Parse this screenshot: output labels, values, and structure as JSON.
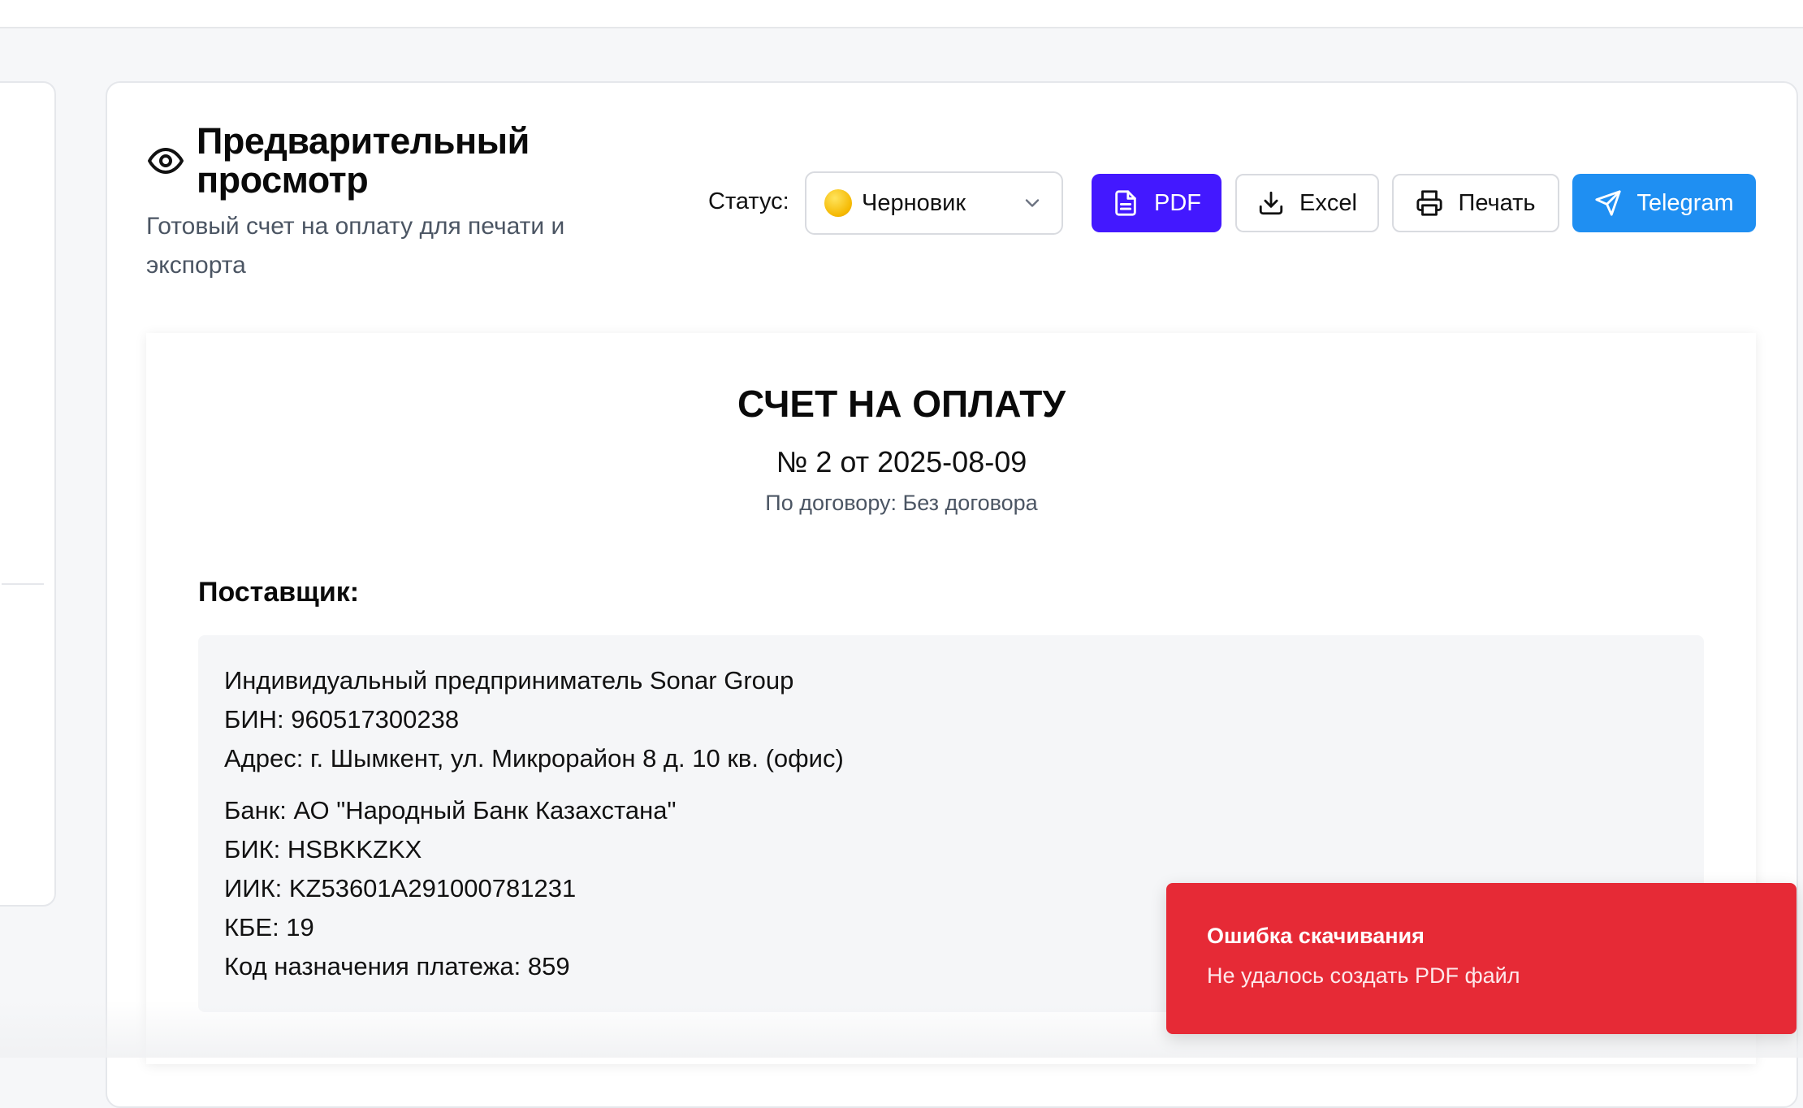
{
  "preview": {
    "title": "Предварительный просмотр",
    "subtitle": "Готовый счет на оплату для печати и экспорта",
    "icon": "eye-icon"
  },
  "status": {
    "label": "Статус:",
    "selected": "Черновик",
    "dot_color": "#f5b800"
  },
  "actions": {
    "pdf": "PDF",
    "excel": "Excel",
    "print": "Печать",
    "telegram": "Telegram",
    "pdf_color": "#4318ff",
    "telegram_color": "#1f8ff2"
  },
  "invoice": {
    "title": "СЧЕТ НА ОПЛАТУ",
    "number_line": "№ 2 от 2025-08-09",
    "contract_line": "По договору: Без договора",
    "supplier_label": "Поставщик:",
    "supplier": {
      "name": "Индивидуальный предприниматель Sonar Group",
      "bin": "БИН: 960517300238",
      "address": "Адрес: г. Шымкент, ул. Микрорайон 8 д. 10 кв. (офис)",
      "bank": "Банк: АО \"Народный Банк Казахстана\"",
      "bik": "БИК: HSBKKZKX",
      "iik": "ИИК: KZ53601A291000781231",
      "kbe": "КБЕ: 19",
      "payment_code": "Код назначения платежа: 859"
    }
  },
  "toast": {
    "title": "Ошибка скачивания",
    "message": "Не удалось создать PDF файл",
    "color": "#e62a36"
  }
}
